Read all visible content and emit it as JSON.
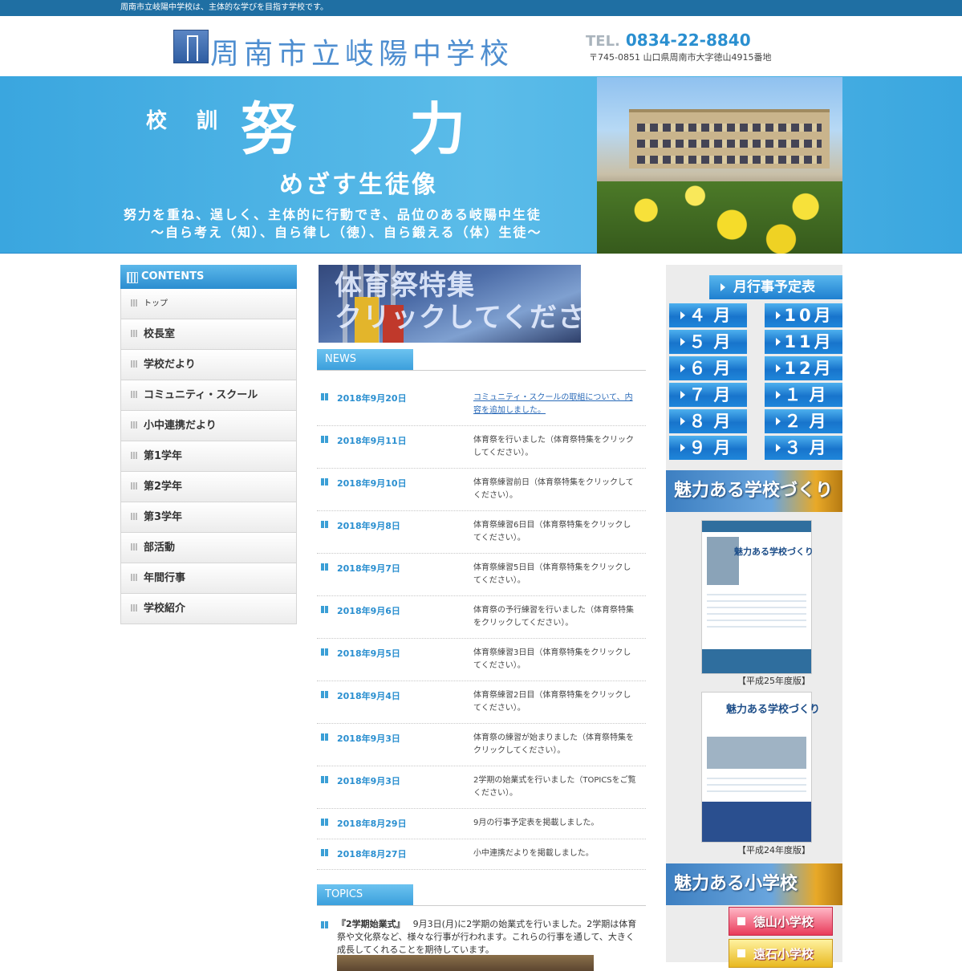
{
  "topbar": {
    "tagline": "周南市立岐陽中学校は、主体的な学びを目指す学校です。"
  },
  "header": {
    "school_name": "周南市立岐陽中学校",
    "tel_label": "TEL.",
    "tel_number": "0834-22-8840",
    "address": "〒745-0851 山口県周南市大字徳山4915番地"
  },
  "banner": {
    "motto_label": "校 訓",
    "motto": "努力",
    "goal_title": "めざす生徒像",
    "goal_line1": "努力を重ね、逞しく、主体的に行動でき、品位のある岐陽中生徒",
    "goal_line2": "〜自ら考え（知）、自ら律し（徳）、自ら鍛える（体）生徒〜"
  },
  "sidebar": {
    "heading": "CONTENTS",
    "items": [
      {
        "label": "トップ"
      },
      {
        "label": "校長室"
      },
      {
        "label": "学校だより"
      },
      {
        "label": "コミュニティ・スクール"
      },
      {
        "label": "小中連携だより"
      },
      {
        "label": "第1学年"
      },
      {
        "label": "第2学年"
      },
      {
        "label": "第3学年"
      },
      {
        "label": "部活動"
      },
      {
        "label": "年間行事"
      },
      {
        "label": "学校紹介"
      }
    ]
  },
  "feature": {
    "text_line1": "体育祭特集",
    "text_line2": "クリックしてください"
  },
  "news": {
    "heading": "NEWS",
    "items": [
      {
        "date": "2018年9月20日",
        "text": "コミュニティ・スクールの取組について、内容を追加しました。"
      },
      {
        "date": "2018年9月11日",
        "text": "体育祭を行いました（体育祭特集をクリックしてください）。"
      },
      {
        "date": "2018年9月10日",
        "text": "体育祭練習前日（体育祭特集をクリックしてください）。"
      },
      {
        "date": "2018年9月8日",
        "text": "体育祭練習6日目（体育祭特集をクリックしてください）。"
      },
      {
        "date": "2018年9月7日",
        "text": "体育祭練習5日目（体育祭特集をクリックしてください）。"
      },
      {
        "date": "2018年9月6日",
        "text": "体育祭の予行練習を行いました（体育祭特集をクリックしてください）。"
      },
      {
        "date": "2018年9月5日",
        "text": "体育祭練習3日目（体育祭特集をクリックしてください）。"
      },
      {
        "date": "2018年9月4日",
        "text": "体育祭練習2日目（体育祭特集をクリックしてください）。"
      },
      {
        "date": "2018年9月3日",
        "text": "体育祭の練習が始まりました（体育祭特集をクリックしてください）。"
      },
      {
        "date": "2018年9月3日",
        "text": "2学期の始業式を行いました（TOPICSをご覧ください）。"
      },
      {
        "date": "2018年8月29日",
        "text": "9月の行事予定表を掲載しました。"
      },
      {
        "date": "2018年8月27日",
        "text": "小中連携だよりを掲載しました。"
      }
    ]
  },
  "topics": {
    "heading": "TOPICS",
    "item_title": "『2学期始業式』",
    "item_text": "9月3日(月)に2学期の始業式を行いました。2学期は体育祭や文化祭など、様々な行事が行われます。これらの行事を通して、大きく成長してくれることを期待しています。"
  },
  "right": {
    "month_title": "月行事予定表",
    "months_left": [
      "４月",
      "５月",
      "６月",
      "７月",
      "８月",
      "９月"
    ],
    "months_right": [
      "10月",
      "11月",
      "12月",
      "１月",
      "２月",
      "３月"
    ],
    "promo1": "魅力ある学校づくり",
    "brochure1_title": "魅力ある学校づくり",
    "brochure1_caption": "【平成25年度版】",
    "brochure2_title": "魅力ある学校づくり",
    "brochure2_caption": "【平成24年度版】",
    "promo2": "魅力ある小学校",
    "school1": "徳山小学校",
    "school2": "遠石小学校"
  }
}
